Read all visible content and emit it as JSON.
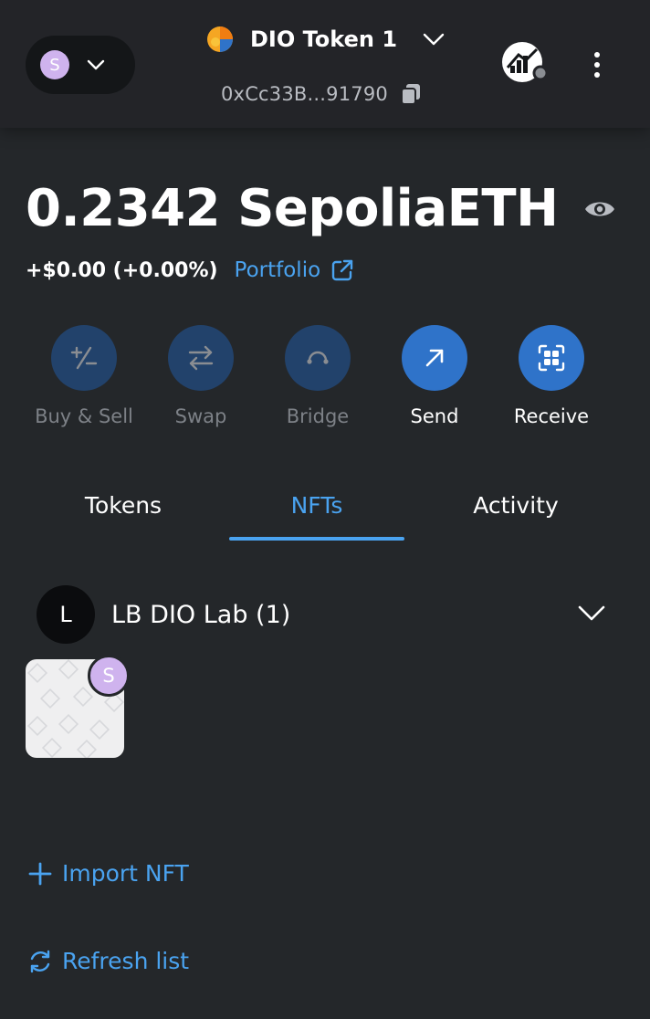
{
  "header": {
    "network_avatar_letter": "S",
    "account_name": "DIO Token 1",
    "address": "0xCc33B...91790"
  },
  "balance": {
    "amount": "0.2342 SepoliaETH",
    "change": "+$0.00 (+0.00%)",
    "portfolio_label": "Portfolio"
  },
  "actions": [
    {
      "label": "Buy & Sell",
      "icon": "plus-minus-icon",
      "enabled": false
    },
    {
      "label": "Swap",
      "icon": "swap-arrows-icon",
      "enabled": false
    },
    {
      "label": "Bridge",
      "icon": "bridge-icon",
      "enabled": false
    },
    {
      "label": "Send",
      "icon": "arrow-up-right-icon",
      "enabled": true
    },
    {
      "label": "Receive",
      "icon": "qr-scan-icon",
      "enabled": true
    }
  ],
  "tabs": [
    {
      "label": "Tokens",
      "active": false
    },
    {
      "label": "NFTs",
      "active": true
    },
    {
      "label": "Activity",
      "active": false
    }
  ],
  "collection": {
    "avatar_letter": "L",
    "name": "LB DIO Lab (1)",
    "nft_badge_letter": "S"
  },
  "links": {
    "import_nft": "Import NFT",
    "refresh_list": "Refresh list"
  },
  "colors": {
    "background": "#24272a",
    "accent": "#4aa3f0",
    "button_enabled": "#2f73c9",
    "button_disabled": "#22426b",
    "network_avatar": "#cfb3ee"
  }
}
